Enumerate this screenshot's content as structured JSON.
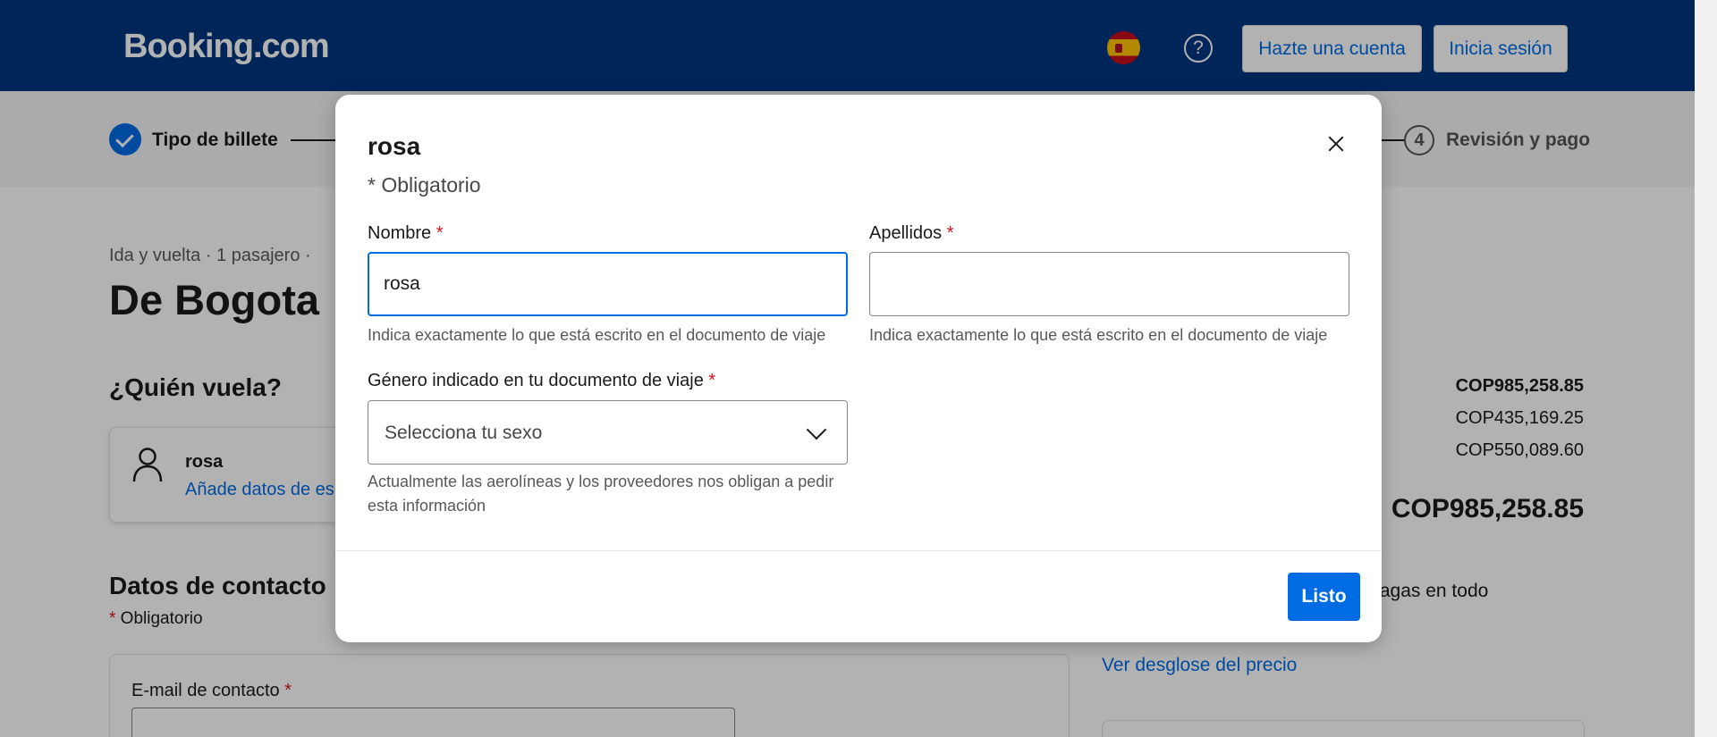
{
  "header": {
    "logo": "Booking.com",
    "signup_label": "Hazte una cuenta",
    "signin_label": "Inicia sesión",
    "help_icon": "?"
  },
  "stepper": {
    "step1_label": "Tipo de billete",
    "step4_number": "4",
    "step4_label": "Revisión y pago"
  },
  "page": {
    "trip_meta": "Ida y vuelta · 1 pasajero ·",
    "route_title": "De Bogota",
    "who_flies": "¿Quién vuela?",
    "passenger_name": "rosa",
    "passenger_link": "Añade datos de es",
    "contact_title": "Datos de contacto",
    "contact_required_star": "*",
    "contact_required": " Obligatorio",
    "email_label": "E-mail de contacto",
    "email_star": " *",
    "price_total_top": "COP985,258.85",
    "price_line2": "COP435,169.25",
    "price_line3": "COP550,089.60",
    "price_total": "COP985,258.85",
    "pay_note": "ue pagas en todo",
    "breakdown_link": "Ver desglose del precio"
  },
  "modal": {
    "title": "rosa",
    "required_note": "* Obligatorio",
    "first_name_label": "Nombre",
    "first_name_star": " *",
    "first_name_value": "rosa",
    "first_name_hint": "Indica exactamente lo que está escrito en el documento de viaje",
    "last_name_label": "Apellidos",
    "last_name_star": " *",
    "last_name_value": "",
    "last_name_hint": "Indica exactamente lo que está escrito en el documento de viaje",
    "gender_label": "Género indicado en tu documento de viaje",
    "gender_star": " *",
    "gender_value": "Selecciona tu sexo",
    "gender_hint": "Actualmente las aerolíneas y los proveedores nos obligan a pedir esta información",
    "done_label": "Listo"
  },
  "colors": {
    "brand_blue": "#003580",
    "action_blue": "#006ce4",
    "required_red": "#d4111e"
  }
}
